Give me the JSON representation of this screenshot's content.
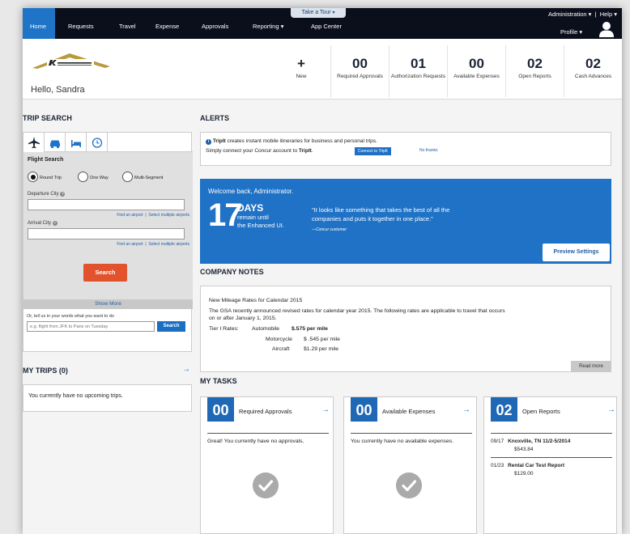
{
  "nav": {
    "home": "Home",
    "requests": "Requests",
    "travel": "Travel",
    "expense": "Expense",
    "approvals": "Approvals",
    "reporting": "Reporting",
    "app_center": "App Center",
    "take_tour": "Take a Tour",
    "administration": "Administration",
    "help": "Help",
    "profile": "Profile"
  },
  "header": {
    "greeting": "Hello, Sandra",
    "stats": [
      {
        "icon": "+",
        "label": "New"
      },
      {
        "num": "00",
        "label": "Required Approvals"
      },
      {
        "num": "01",
        "label": "Authorization Requests"
      },
      {
        "num": "00",
        "label": "Available Expenses"
      },
      {
        "num": "02",
        "label": "Open Reports"
      },
      {
        "num": "02",
        "label": "Cash Advances"
      }
    ]
  },
  "trip_search": {
    "title": "TRIP SEARCH",
    "flight_search": "Flight Search",
    "round_trip": "Round Trip",
    "one_way": "One Way",
    "multi_segment": "Multi-Segment",
    "departure_label": "Departure City",
    "arrival_label": "Arrival City",
    "find_airport": "Find an airport",
    "select_multiple": "Select multiple airports",
    "search_button": "Search",
    "show_more": "Show More",
    "nl_label": "Or, tell us in your words what you want to do",
    "nl_placeholder": "e.g. flight from JFK to Paris on Tuesday",
    "nl_button": "Search"
  },
  "my_trips": {
    "title": "MY TRIPS (0)",
    "empty": "You currently have no upcoming trips."
  },
  "alerts": {
    "title": "ALERTS",
    "line1_bold": "TripIt",
    "line1": "creates instant mobile itineraries for business and personal trips.",
    "line2_start": "Simply connect your Concur account to",
    "line2_bold": "TripIt",
    "connect_button": "Connect to TripIt",
    "no_thanks": "No thanks"
  },
  "welcome": {
    "title": "Welcome back, Administrator.",
    "days_num": "17",
    "days_label": "DAYS",
    "remain_line1": "remain until",
    "remain_line2": "the Enhanced UI.",
    "quote_line1": "\"It looks like something that takes the best of all the",
    "quote_line2": "companies and puts it together in one place.\"",
    "cite": "—Concur customer",
    "preview_button": "Preview Settings"
  },
  "company_notes": {
    "title": "COMPANY NOTES",
    "heading": "New Mileage Rates for Calendar 2015",
    "body1": "The GSA recently announced revised rates for calendar year 2015.  The following rates are applicable to travel that occurs",
    "body2": "on or after January 1, 2015.",
    "tier": "Tier I Rates:",
    "rate1_name": "Automobile",
    "rate1_val": "$.575 per mile",
    "rate2_name": "Motorcycle",
    "rate2_val": "$ .545 per mile",
    "rate3_name": "Aircraft",
    "rate3_val": "$1.29 per mile",
    "read_more": "Read more"
  },
  "my_tasks": {
    "title": "MY TASKS",
    "cards": [
      {
        "num": "00",
        "title": "Required Approvals",
        "body": "Great! You currently have no approvals."
      },
      {
        "num": "00",
        "title": "Available Expenses",
        "body": "You currently have no available expenses."
      },
      {
        "num": "02",
        "title": "Open Reports"
      }
    ],
    "reports": [
      {
        "date": "09/17",
        "name": "Knoxville, TN 11/2-5/2014",
        "amount": "$543.84"
      },
      {
        "date": "01/23",
        "name": "Rental Car Test Report",
        "amount": "$129.00"
      }
    ]
  }
}
